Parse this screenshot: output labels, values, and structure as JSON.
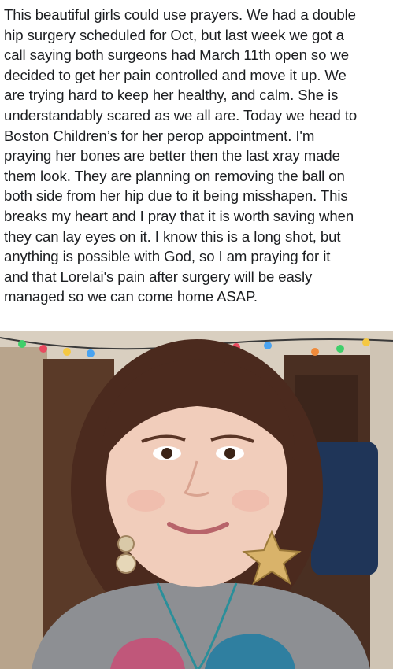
{
  "post": {
    "text": "This beautiful girls could use prayers. We had a double\nhip surgery scheduled for Oct, but last week we got a\ncall saying both surgeons had March 11th open so we\ndecided to get her pain controlled and move it up. We\nare trying hard to keep her healthy, and calm. She is\nunderstandably scared as we all are. Today we head to\nBoston Children’s for her perop appointment. I'm\npraying her bones are better then the last xray made\nthem look. They are planning on removing the ball on\nboth side from her hip due to it being misshapen. This\nbreaks my heart and I pray that it is worth saving when\nthey can lay eyes on it. I know this is a long shot, but\nanything is possible with God, so I am praying for it\nand that Lorelai's pain after surgery will be easly\nmanaged so we can come home ASAP."
  },
  "photo": {
    "subject": "girl-portrait",
    "colors": {
      "wall": "#d9cfc0",
      "door": "#4a2f22",
      "hair": "#4b2a1e",
      "skin": "#f1cdbb",
      "shirt": "#8d8f93"
    }
  }
}
